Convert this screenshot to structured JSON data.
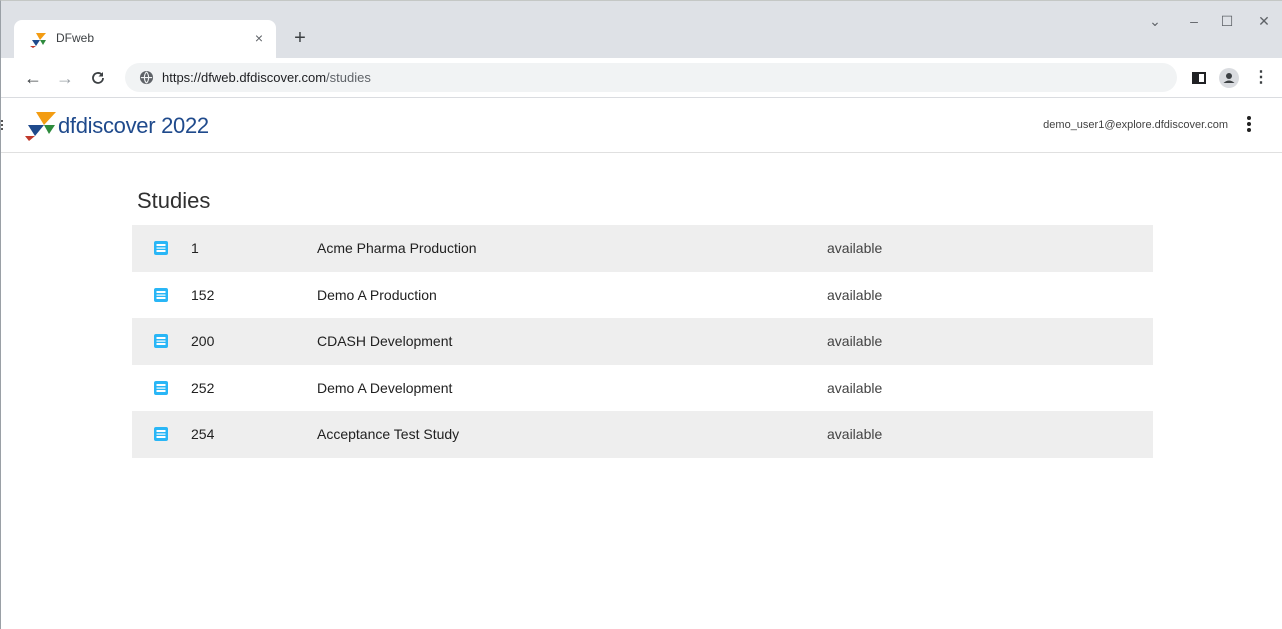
{
  "browser": {
    "tab_title": "DFweb",
    "tab_close": "×",
    "new_tab": "+",
    "url_host": "https://dfweb.dfdiscover.com",
    "url_path": "/studies",
    "window_controls": {
      "minimize": "–",
      "maximize": "☐",
      "close": "✕",
      "dropdown": "⌄"
    }
  },
  "app": {
    "logo_name": "dfdiscover",
    "logo_year": "2022",
    "user_email": "demo_user1@explore.dfdiscover.com"
  },
  "page": {
    "title": "Studies"
  },
  "studies": [
    {
      "id": "1",
      "name": "Acme Pharma Production",
      "status": "available"
    },
    {
      "id": "152",
      "name": "Demo A Production",
      "status": "available"
    },
    {
      "id": "200",
      "name": "CDASH Development",
      "status": "available"
    },
    {
      "id": "252",
      "name": "Demo A Development",
      "status": "available"
    },
    {
      "id": "254",
      "name": "Acceptance Test Study",
      "status": "available"
    }
  ],
  "colors": {
    "row_shaded": "#eeeeee",
    "study_icon": "#29b6f6",
    "logo_text": "#1f4a8c"
  }
}
